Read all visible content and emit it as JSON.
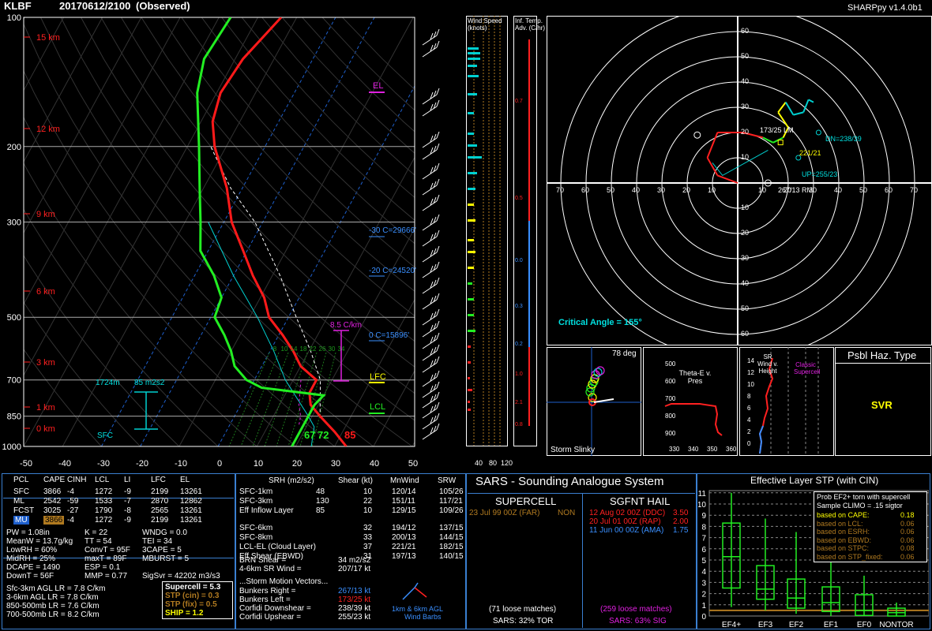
{
  "header": {
    "station": "KLBF",
    "datetime": "20170612/2100",
    "status": "(Observed)",
    "app": "SHARPpy v1.4.0b1"
  },
  "skewt": {
    "pressure_ticks": [
      "100",
      "200",
      "300",
      "500",
      "700",
      "850",
      "1000"
    ],
    "temp_ticks": [
      "-50",
      "-40",
      "-30",
      "-20",
      "-10",
      "0",
      "10",
      "20",
      "30",
      "40",
      "50"
    ],
    "height_labels": [
      "15 km",
      "12 km",
      "9 km",
      "6 km",
      "3 km",
      "1 km",
      "0 km"
    ],
    "labels": {
      "el": "EL",
      "lfc": "LFC",
      "lcl": "LCL",
      "m30": "-30 C=29666'",
      "m20": "-20 C=24520'",
      "zero": "0 C=15896'",
      "lapse": "8.5 C/km",
      "sfc": "SFC",
      "inflow_base": "1724m",
      "inflow_srh": "85 m2s2",
      "sfc_td": "67",
      "sfc_tw": "72",
      "sfc_t": "85"
    },
    "mixing_ratios": [
      "8",
      "10",
      "14",
      "18",
      "22",
      "26",
      "30",
      "34"
    ]
  },
  "chart_data": {
    "type": "line",
    "title": "",
    "xlabel": "",
    "ylabel": "",
    "xlim": [
      -50,
      50
    ],
    "ylim": [
      1000,
      100
    ],
    "series": [
      {
        "name": "Temperature",
        "color": "#ff1a1a",
        "points": [
          [
            1000,
            33
          ],
          [
            925,
            28
          ],
          [
            850,
            22
          ],
          [
            800,
            18
          ],
          [
            750,
            16
          ],
          [
            700,
            16
          ],
          [
            650,
            10
          ],
          [
            600,
            6
          ],
          [
            550,
            1
          ],
          [
            500,
            -5
          ],
          [
            450,
            -9
          ],
          [
            400,
            -15
          ],
          [
            350,
            -21
          ],
          [
            300,
            -28
          ],
          [
            250,
            -34
          ],
          [
            200,
            -43
          ],
          [
            175,
            -47
          ],
          [
            150,
            -49
          ],
          [
            125,
            -48
          ],
          [
            100,
            -44
          ]
        ]
      },
      {
        "name": "Dewpoint",
        "color": "#22ee22",
        "points": [
          [
            1000,
            19
          ],
          [
            925,
            19
          ],
          [
            850,
            19
          ],
          [
            800,
            19
          ],
          [
            760,
            20
          ],
          [
            730,
            3
          ],
          [
            700,
            -2
          ],
          [
            650,
            -7
          ],
          [
            600,
            -10
          ],
          [
            550,
            -14
          ],
          [
            500,
            -19
          ],
          [
            450,
            -20
          ],
          [
            400,
            -25
          ],
          [
            350,
            -32
          ],
          [
            300,
            -36
          ],
          [
            250,
            -41
          ],
          [
            200,
            -47
          ],
          [
            150,
            -55
          ],
          [
            125,
            -58
          ],
          [
            100,
            -57
          ]
        ]
      }
    ]
  },
  "panels": {
    "wind_speed": {
      "title": "Wind Speed (knots)",
      "ticks": [
        "40",
        "80",
        "120"
      ]
    },
    "inf_temp": {
      "title": "Inf. Temp. Adv. (C/hr)",
      "values": [
        "0.7",
        "0.5",
        "0.0",
        "0.3",
        "0.2",
        "1.0",
        "2.1",
        "0.8"
      ]
    },
    "hodograph": {
      "rings": [
        "10",
        "20",
        "30",
        "40",
        "50",
        "60"
      ],
      "x_ticks": [
        "70",
        "60",
        "50",
        "40",
        "30",
        "20",
        "10",
        "10",
        "20",
        "30",
        "40",
        "50",
        "60",
        "70"
      ],
      "critical_angle": "Critical Angle = 155°",
      "lm": "173/25 LM",
      "rm": "267/13 RM",
      "dn": "DN=238/39",
      "up": "UP=255/23",
      "mean": "221/21"
    },
    "storm_slinky": {
      "title": "Storm Slinky",
      "deg": "78 deg"
    },
    "theta": {
      "title": "Theta-E v. Pres",
      "y": [
        "500",
        "600",
        "700",
        "800",
        "900"
      ],
      "x": [
        "330",
        "340",
        "350",
        "360"
      ]
    },
    "srwind": {
      "title": "SR Wind v. Height",
      "label": "Classic Supercell",
      "y": [
        "14",
        "12",
        "10",
        "8",
        "6",
        "4",
        "2",
        "0"
      ],
      "x": [
        "0",
        "20",
        "40",
        "60",
        "80"
      ]
    },
    "haz": {
      "title": "Psbl Haz. Type",
      "value": "SVR"
    }
  },
  "parcels": {
    "headers": [
      "PCL",
      "CAPE",
      "CINH",
      "LCL",
      "LI",
      "LFC",
      "EL"
    ],
    "rows": [
      [
        "SFC",
        "3866",
        "-4",
        "1272",
        "-9",
        "2199",
        "13261"
      ],
      [
        "ML",
        "2542",
        "-59",
        "1533",
        "-7",
        "2870",
        "12862"
      ],
      [
        "FCST",
        "3025",
        "-27",
        "1790",
        "-8",
        "2565",
        "13261"
      ],
      [
        "MU",
        "3866",
        "-4",
        "1272",
        "-9",
        "2199",
        "13261"
      ]
    ]
  },
  "indices": {
    "col1": [
      "PW = 1.08in",
      "MeanW = 13.7g/kg",
      "LowRH = 60%",
      "MidRH = 25%",
      "DCAPE = 1490",
      "DownT = 56F"
    ],
    "col2": [
      "K = 22",
      "TT = 54",
      "ConvT = 95F",
      "maxT = 89F",
      "ESP = 0.1",
      "MMP = 0.77"
    ],
    "col3": [
      "WNDG = 0.0",
      "TEI = 34",
      "3CAPE = 5",
      "MBURST = 5",
      "",
      "SigSvr = 42202 m3/s3"
    ],
    "lapse": [
      "Sfc-3km AGL LR = 7.8 C/km",
      "3-6km AGL LR = 7.8 C/km",
      "850-500mb LR = 7.6 C/km",
      "700-500mb LR = 8.2 C/km"
    ],
    "composite": [
      "Supercell = 5.3",
      "STP (cin) = 0.3",
      "STP (fix) = 0.5",
      "SHIP = 1.2"
    ]
  },
  "kinematics": {
    "headers": [
      "SRH (m2/s2)",
      "Shear (kt)",
      "MnWind",
      "SRW"
    ],
    "rows": [
      [
        "SFC-1km",
        "48",
        "10",
        "120/14",
        "105/26"
      ],
      [
        "SFC-3km",
        "130",
        "22",
        "151/11",
        "117/21"
      ],
      [
        "Eff Inflow Layer",
        "85",
        "10",
        "129/15",
        "109/26"
      ],
      [
        "SFC-6km",
        "",
        "32",
        "194/12",
        "137/15"
      ],
      [
        "SFC-8km",
        "",
        "33",
        "200/13",
        "144/15"
      ],
      [
        "LCL-EL (Cloud Layer)",
        "",
        "37",
        "221/21",
        "182/15"
      ],
      [
        "Eff Shear (EBWD)",
        "",
        "31",
        "197/13",
        "140/15"
      ]
    ],
    "brn": [
      "BRN Shear =",
      "34 m2/s2"
    ],
    "sr46": [
      "4-6km SR Wind =",
      "207/17 kt"
    ],
    "vectors_title": "...Storm Motion Vectors...",
    "vectors": [
      [
        "Bunkers Right =",
        "267/13 kt"
      ],
      [
        "Bunkers Left =",
        "173/25 kt"
      ],
      [
        "Corfidi Downshear =",
        "238/39 kt"
      ],
      [
        "Corfidi Upshear =",
        "255/23 kt"
      ]
    ],
    "barb_label": [
      "1km & 6km AGL",
      "Wind Barbs"
    ]
  },
  "sars": {
    "title": "SARS - Sounding Analogue System",
    "supercell_title": "SUPERCELL",
    "supercell_match": [
      "23 Jul 99 00Z (FAR)",
      "NON"
    ],
    "supercell_loose": "(71 loose matches)",
    "supercell_sars": "SARS: 32% TOR",
    "hail_title": "SGFNT HAIL",
    "hail_matches": [
      [
        "12 Aug 02 00Z (DDC)",
        "3.50"
      ],
      [
        "20 Jul 01 00Z (RAP)",
        "2.00"
      ],
      [
        "11 Jun 00 00Z (AMA)",
        "1.75"
      ]
    ],
    "hail_loose": "(259 loose matches)",
    "hail_sars": "SARS: 63% SIG"
  },
  "stp": {
    "title": "Effective Layer STP (with CIN)",
    "legend_title": [
      "Prob EF2+ torn with supercell",
      "Sample CLIMO = .15 sigtor"
    ],
    "legend_rows": [
      [
        "based on CAPE:",
        "0.18"
      ],
      [
        "based on LCL:",
        "0.06"
      ],
      [
        "based on ESRH:",
        "0.06"
      ],
      [
        "based on EBWD:",
        "0.06"
      ],
      [
        "based on STPC:",
        "0.08"
      ],
      [
        "based on STP_fixed:",
        "0.06"
      ]
    ],
    "y_ticks": [
      "11",
      "10",
      "9",
      "8",
      "7",
      "6",
      "5",
      "4",
      "3",
      "2",
      "1",
      "0"
    ],
    "categories": [
      "EF4+",
      "EF3",
      "EF2",
      "EF1",
      "EF0",
      "NONTOR"
    ]
  }
}
